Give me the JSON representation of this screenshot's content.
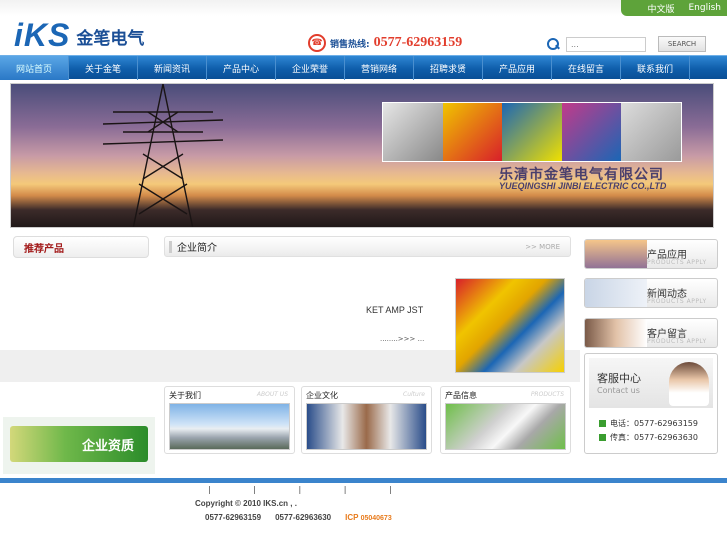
{
  "lang": {
    "cn": "中文版",
    "en": "English"
  },
  "logo": {
    "brand": "iKS",
    "cn": "金笔电气"
  },
  "hotline": {
    "label": "销售热线:",
    "number": "0577-62963159"
  },
  "search": {
    "placeholder": "...",
    "button": "SEARCH"
  },
  "nav": [
    {
      "label": "网站首页"
    },
    {
      "label": "关于金笔"
    },
    {
      "label": "新闻资讯"
    },
    {
      "label": "产品中心"
    },
    {
      "label": "企业荣誉"
    },
    {
      "label": "营销网络"
    },
    {
      "label": "招聘求贤"
    },
    {
      "label": "产品应用"
    },
    {
      "label": "在线留言"
    },
    {
      "label": "联系我们"
    }
  ],
  "banner": {
    "company_cn": "乐清市金笔电气有限公司",
    "company_en": "YUEQINGSHI JINBI ELECTRIC CO.,LTD"
  },
  "sidebar": {
    "recommend": "推荐产品",
    "qualification": "企业资质"
  },
  "intro": {
    "title": "企业简介",
    "more": "MORE",
    "text": "KET AMP JST",
    "link": "........>>> ..."
  },
  "right_tiles": [
    {
      "title": "产品应用",
      "en": "PRODUCTS APPLY"
    },
    {
      "title": "新闻动态",
      "en": "PRODUCTS APPLY"
    },
    {
      "title": "客户留言",
      "en": "PRODUCTS APPLY"
    }
  ],
  "service": {
    "title": "客服中心",
    "en": "Contact us",
    "phone": "电话：0577-62963159",
    "fax": "传真：0577-62963630"
  },
  "cards": [
    {
      "title": "关于我们",
      "en": "ABOUT US"
    },
    {
      "title": "企业文化",
      "en": "Culture"
    },
    {
      "title": "产品信息",
      "en": "PRODUCTS"
    }
  ],
  "footer": {
    "bars": "| | | | |",
    "copyright": "Copyright © 2010 IKS.cn          ,          .",
    "tel1": "0577-62963159",
    "tel2": "0577-62963630",
    "icp": "ICP",
    "icp_no": "05040673"
  },
  "colors": {
    "nav": "#0f5eab",
    "green": "#5ea33a",
    "accent": "#e23d2c"
  }
}
